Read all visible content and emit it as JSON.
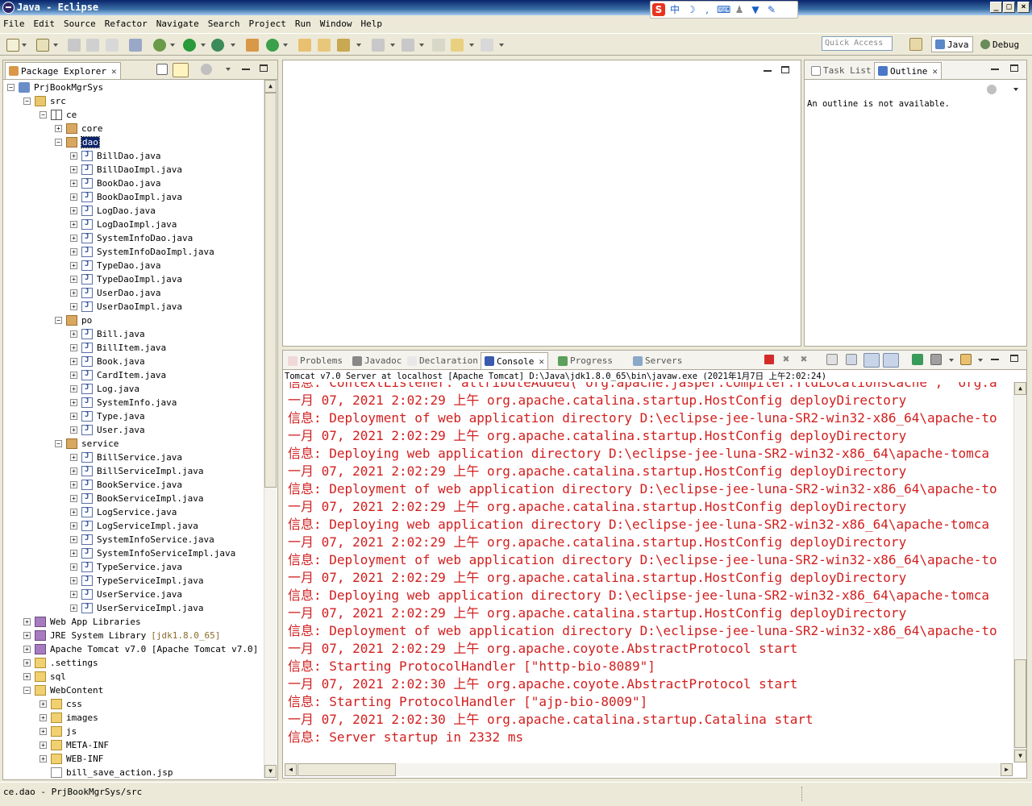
{
  "window": {
    "title": "Java - Eclipse",
    "controls": [
      "_",
      "□",
      "×"
    ]
  },
  "ime_toolbar": {
    "logo": "S",
    "mode": "中",
    "icons": [
      "moon-icon",
      "comma-icon",
      "keyboard-icon",
      "user-icon",
      "shirt-icon",
      "wrench-icon"
    ]
  },
  "menu": [
    "File",
    "Edit",
    "Source",
    "Refactor",
    "Navigate",
    "Search",
    "Project",
    "Run",
    "Window",
    "Help"
  ],
  "toolbar": {
    "quick_access_placeholder": "Quick Access",
    "perspectives": [
      {
        "label": "Java",
        "active": true
      },
      {
        "label": "Debug",
        "active": false
      }
    ]
  },
  "package_explorer": {
    "tab_label": "Package Explorer",
    "tree": [
      {
        "label": "PrjBookMgrSys",
        "icon": "project",
        "level": 0,
        "expander": "-"
      },
      {
        "label": "src",
        "icon": "srcfolder",
        "level": 1,
        "expander": "-"
      },
      {
        "label": "ce",
        "icon": "package-empty",
        "level": 2,
        "expander": "-"
      },
      {
        "label": "core",
        "icon": "package",
        "level": 3,
        "expander": "+"
      },
      {
        "label": "dao",
        "icon": "package",
        "level": 3,
        "expander": "-",
        "selected": true
      },
      {
        "label": "BillDao.java",
        "icon": "java",
        "level": 4,
        "expander": "+"
      },
      {
        "label": "BillDaoImpl.java",
        "icon": "java",
        "level": 4,
        "expander": "+"
      },
      {
        "label": "BookDao.java",
        "icon": "java",
        "level": 4,
        "expander": "+"
      },
      {
        "label": "BookDaoImpl.java",
        "icon": "java",
        "level": 4,
        "expander": "+"
      },
      {
        "label": "LogDao.java",
        "icon": "java",
        "level": 4,
        "expander": "+"
      },
      {
        "label": "LogDaoImpl.java",
        "icon": "java",
        "level": 4,
        "expander": "+"
      },
      {
        "label": "SystemInfoDao.java",
        "icon": "java",
        "level": 4,
        "expander": "+"
      },
      {
        "label": "SystemInfoDaoImpl.java",
        "icon": "java",
        "level": 4,
        "expander": "+"
      },
      {
        "label": "TypeDao.java",
        "icon": "java",
        "level": 4,
        "expander": "+"
      },
      {
        "label": "TypeDaoImpl.java",
        "icon": "java",
        "level": 4,
        "expander": "+"
      },
      {
        "label": "UserDao.java",
        "icon": "java",
        "level": 4,
        "expander": "+"
      },
      {
        "label": "UserDaoImpl.java",
        "icon": "java",
        "level": 4,
        "expander": "+"
      },
      {
        "label": "po",
        "icon": "package",
        "level": 3,
        "expander": "-"
      },
      {
        "label": "Bill.java",
        "icon": "java",
        "level": 4,
        "expander": "+"
      },
      {
        "label": "BillItem.java",
        "icon": "java",
        "level": 4,
        "expander": "+"
      },
      {
        "label": "Book.java",
        "icon": "java",
        "level": 4,
        "expander": "+"
      },
      {
        "label": "CardItem.java",
        "icon": "java",
        "level": 4,
        "expander": "+"
      },
      {
        "label": "Log.java",
        "icon": "java",
        "level": 4,
        "expander": "+"
      },
      {
        "label": "SystemInfo.java",
        "icon": "java",
        "level": 4,
        "expander": "+"
      },
      {
        "label": "Type.java",
        "icon": "java",
        "level": 4,
        "expander": "+"
      },
      {
        "label": "User.java",
        "icon": "java",
        "level": 4,
        "expander": "+"
      },
      {
        "label": "service",
        "icon": "package",
        "level": 3,
        "expander": "-"
      },
      {
        "label": "BillService.java",
        "icon": "java",
        "level": 4,
        "expander": "+"
      },
      {
        "label": "BillServiceImpl.java",
        "icon": "java",
        "level": 4,
        "expander": "+"
      },
      {
        "label": "BookService.java",
        "icon": "java",
        "level": 4,
        "expander": "+"
      },
      {
        "label": "BookServiceImpl.java",
        "icon": "java",
        "level": 4,
        "expander": "+"
      },
      {
        "label": "LogService.java",
        "icon": "java",
        "level": 4,
        "expander": "+"
      },
      {
        "label": "LogServiceImpl.java",
        "icon": "java",
        "level": 4,
        "expander": "+"
      },
      {
        "label": "SystemInfoService.java",
        "icon": "java",
        "level": 4,
        "expander": "+"
      },
      {
        "label": "SystemInfoServiceImpl.java",
        "icon": "java",
        "level": 4,
        "expander": "+"
      },
      {
        "label": "TypeService.java",
        "icon": "java",
        "level": 4,
        "expander": "+"
      },
      {
        "label": "TypeServiceImpl.java",
        "icon": "java",
        "level": 4,
        "expander": "+"
      },
      {
        "label": "UserService.java",
        "icon": "java",
        "level": 4,
        "expander": "+"
      },
      {
        "label": "UserServiceImpl.java",
        "icon": "java",
        "level": 4,
        "expander": "+"
      },
      {
        "label": "Web App Libraries",
        "icon": "lib",
        "level": 1,
        "expander": "+"
      },
      {
        "label": "JRE System Library",
        "suffix": "[jdk1.8.0_65]",
        "icon": "lib",
        "level": 1,
        "expander": "+"
      },
      {
        "label": "Apache Tomcat v7.0 [Apache Tomcat v7.0]",
        "icon": "lib",
        "level": 1,
        "expander": "+"
      },
      {
        "label": ".settings",
        "icon": "folder",
        "level": 1,
        "expander": "+"
      },
      {
        "label": "sql",
        "icon": "folder",
        "level": 1,
        "expander": "+"
      },
      {
        "label": "WebContent",
        "icon": "folder",
        "level": 1,
        "expander": "-"
      },
      {
        "label": "css",
        "icon": "folder",
        "level": 2,
        "expander": "+"
      },
      {
        "label": "images",
        "icon": "folder",
        "level": 2,
        "expander": "+"
      },
      {
        "label": "js",
        "icon": "folder",
        "level": 2,
        "expander": "+"
      },
      {
        "label": "META-INF",
        "icon": "folder",
        "level": 2,
        "expander": "+"
      },
      {
        "label": "WEB-INF",
        "icon": "folder",
        "level": 2,
        "expander": "+"
      },
      {
        "label": "bill_save_action.jsp",
        "icon": "file",
        "level": 2,
        "expander": ""
      }
    ]
  },
  "outline_panel": {
    "tabs": [
      {
        "label": "Task List",
        "active": false
      },
      {
        "label": "Outline",
        "active": true
      }
    ],
    "message": "An outline is not available."
  },
  "bottom_panel": {
    "tabs": [
      {
        "label": "Problems",
        "active": false
      },
      {
        "label": "Javadoc",
        "active": false
      },
      {
        "label": "Declaration",
        "active": false
      },
      {
        "label": "Console",
        "active": true
      },
      {
        "label": "Progress",
        "active": false
      },
      {
        "label": "Servers",
        "active": false
      }
    ],
    "console_title": "Tomcat v7.0 Server at localhost [Apache Tomcat] D:\\Java\\jdk1.8.0_65\\bin\\javaw.exe (2021年1月7日 上午2:02:24)",
    "console_lines": [
      "信息: ContextListener: attributeAdded('org.apache.jasper.compiler.TldLocationsCache', 'org.a",
      "一月 07, 2021 2:02:29 上午 org.apache.catalina.startup.HostConfig deployDirectory",
      "信息: Deployment of web application directory D:\\eclipse-jee-luna-SR2-win32-x86_64\\apache-to",
      "一月 07, 2021 2:02:29 上午 org.apache.catalina.startup.HostConfig deployDirectory",
      "信息: Deploying web application directory D:\\eclipse-jee-luna-SR2-win32-x86_64\\apache-tomca",
      "一月 07, 2021 2:02:29 上午 org.apache.catalina.startup.HostConfig deployDirectory",
      "信息: Deployment of web application directory D:\\eclipse-jee-luna-SR2-win32-x86_64\\apache-to",
      "一月 07, 2021 2:02:29 上午 org.apache.catalina.startup.HostConfig deployDirectory",
      "信息: Deploying web application directory D:\\eclipse-jee-luna-SR2-win32-x86_64\\apache-tomca",
      "一月 07, 2021 2:02:29 上午 org.apache.catalina.startup.HostConfig deployDirectory",
      "信息: Deployment of web application directory D:\\eclipse-jee-luna-SR2-win32-x86_64\\apache-to",
      "一月 07, 2021 2:02:29 上午 org.apache.catalina.startup.HostConfig deployDirectory",
      "信息: Deploying web application directory D:\\eclipse-jee-luna-SR2-win32-x86_64\\apache-tomca",
      "一月 07, 2021 2:02:29 上午 org.apache.catalina.startup.HostConfig deployDirectory",
      "信息: Deployment of web application directory D:\\eclipse-jee-luna-SR2-win32-x86_64\\apache-to",
      "一月 07, 2021 2:02:29 上午 org.apache.coyote.AbstractProtocol start",
      "信息: Starting ProtocolHandler [\"http-bio-8089\"]",
      "一月 07, 2021 2:02:30 上午 org.apache.coyote.AbstractProtocol start",
      "信息: Starting ProtocolHandler [\"ajp-bio-8009\"]",
      "一月 07, 2021 2:02:30 上午 org.apache.catalina.startup.Catalina start",
      "信息: Server startup in 2332 ms"
    ],
    "console_color": "#d21e1e"
  },
  "status_bar": {
    "text": "ce.dao - PrjBookMgrSys/src"
  }
}
